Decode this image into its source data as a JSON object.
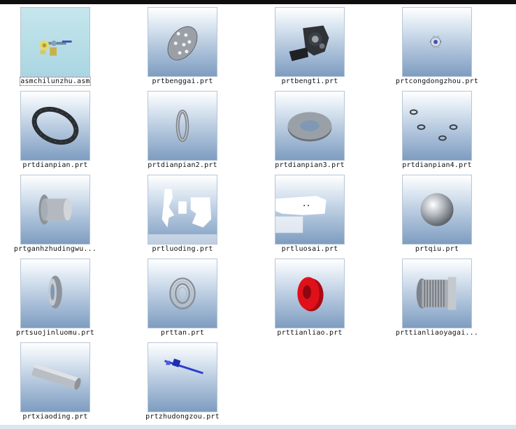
{
  "files": [
    {
      "name": "asmchilunzhu.asm",
      "icon": "gear-assembly-icon",
      "selected": true
    },
    {
      "name": "prtbenggai.prt",
      "icon": "perforated-plate-icon"
    },
    {
      "name": "prtbengti.prt",
      "icon": "pump-body-icon"
    },
    {
      "name": "prtcongdongzhou.prt",
      "icon": "small-gear-icon"
    },
    {
      "name": "prtdianpian.prt",
      "icon": "gasket-icon"
    },
    {
      "name": "prtdianpian2.prt",
      "icon": "thin-ring-icon"
    },
    {
      "name": "prtdianpian3.prt",
      "icon": "flat-washer-icon"
    },
    {
      "name": "prtdianpian4.prt",
      "icon": "small-washers-icon"
    },
    {
      "name": "prtganhzhudingwu...",
      "icon": "flanged-sleeve-icon"
    },
    {
      "name": "prtluoding.prt",
      "icon": "blank-render-icon"
    },
    {
      "name": "prtluosai.prt",
      "icon": "blank-render-icon"
    },
    {
      "name": "prtqiu.prt",
      "icon": "sphere-icon"
    },
    {
      "name": "prtsuojinluomu.prt",
      "icon": "lock-nut-icon"
    },
    {
      "name": "prttan.prt",
      "icon": "spring-icon"
    },
    {
      "name": "prttianliao.prt",
      "icon": "red-ring-icon"
    },
    {
      "name": "prttianliaoyagai...",
      "icon": "threaded-cap-icon"
    },
    {
      "name": "prtxiaoding.prt",
      "icon": "cylinder-pin-icon"
    },
    {
      "name": "prtzhudongzou.prt",
      "icon": "drive-shaft-icon"
    }
  ],
  "colors": {
    "background": "#ffffff",
    "label_text": "#111111",
    "red_part": "#e0101a",
    "blue_part": "#2a3ccf"
  }
}
